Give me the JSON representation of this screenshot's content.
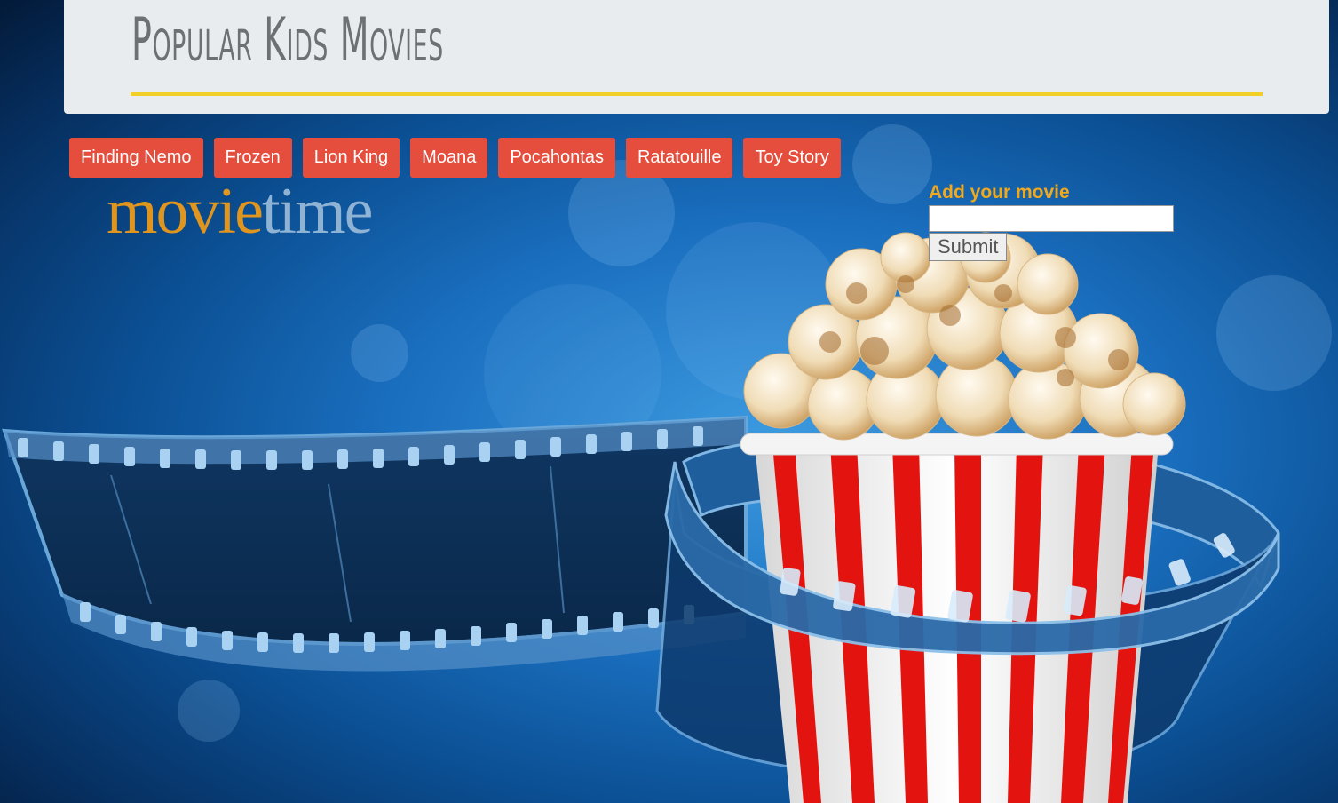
{
  "header": {
    "title": "Popular Kids Movies"
  },
  "nav": {
    "items": [
      {
        "label": "Finding Nemo"
      },
      {
        "label": "Frozen"
      },
      {
        "label": "Lion King"
      },
      {
        "label": "Moana"
      },
      {
        "label": "Pocahontas"
      },
      {
        "label": "Ratatouille"
      },
      {
        "label": "Toy Story"
      }
    ]
  },
  "logo": {
    "part1": "movie",
    "part2": "time"
  },
  "form": {
    "label": "Add your movie",
    "input_value": "",
    "input_placeholder": "",
    "submit_label": "Submit"
  },
  "colors": {
    "nav_button_bg": "#e54d3c",
    "underline": "#f2cf27",
    "form_label": "#f2a81b"
  }
}
